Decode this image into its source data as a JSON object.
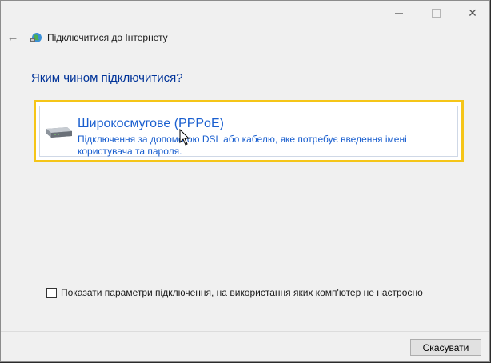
{
  "window": {
    "nav_title": "Підключитися до Інтернету",
    "controls": {
      "minimize_icon": "minimize-icon",
      "maximize_icon": "maximize-icon",
      "close_icon": "close-icon"
    },
    "back_icon": "back-arrow-icon",
    "nav_icon": "network-globe-icon"
  },
  "main": {
    "heading": "Яким чином підключитися?",
    "options": [
      {
        "icon": "broadband-modem-icon",
        "title": "Широкосмугове (PPPoE)",
        "description": "Підключення за допомогою DSL або кабелю, яке потребує введення імені користувача та пароля."
      }
    ],
    "show_all_checkbox": {
      "label": "Показати параметри підключення, на використання яких комп'ютер не настроєно",
      "checked": false
    }
  },
  "footer": {
    "cancel_label": "Скасувати"
  },
  "colors": {
    "link_blue": "#1a5fcf",
    "heading_blue": "#003399",
    "focus_yellow": "#f5c518"
  }
}
